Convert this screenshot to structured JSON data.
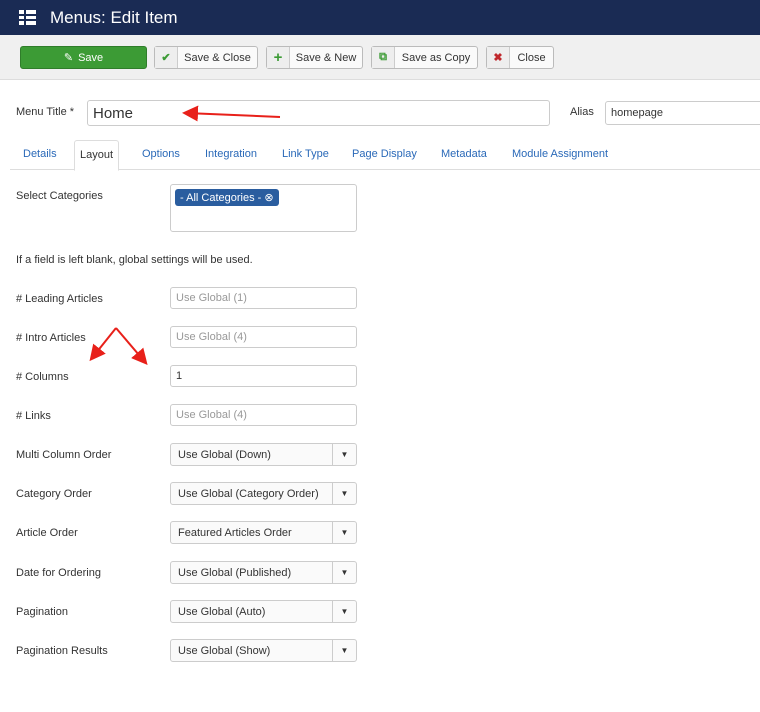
{
  "header": {
    "title": "Menus: Edit Item"
  },
  "toolbar": {
    "save": "Save",
    "save_close": "Save & Close",
    "save_new": "Save & New",
    "save_copy": "Save as Copy",
    "close": "Close"
  },
  "form": {
    "menu_title_label": "Menu Title *",
    "menu_title_value": "Home",
    "alias_label": "Alias",
    "alias_value": "homepage"
  },
  "tabs": [
    "Details",
    "Layout",
    "Options",
    "Integration",
    "Link Type",
    "Page Display",
    "Metadata",
    "Module Assignment"
  ],
  "layout": {
    "select_categories_label": "Select Categories",
    "category_chip": "- All Categories -",
    "note": "If a field is left blank, global settings will be used.",
    "fields": [
      {
        "label": "# Leading Articles",
        "placeholder": "Use Global (1)"
      },
      {
        "label": "# Intro Articles",
        "placeholder": "Use Global (4)"
      },
      {
        "label": "# Columns",
        "value": "1"
      },
      {
        "label": "# Links",
        "placeholder": "Use Global (4)"
      }
    ],
    "selects": [
      {
        "label": "Multi Column Order",
        "value": "Use Global (Down)"
      },
      {
        "label": "Category Order",
        "value": "Use Global (Category Order)"
      },
      {
        "label": "Article Order",
        "value": "Featured Articles Order"
      },
      {
        "label": "Date for Ordering",
        "value": "Use Global (Published)"
      },
      {
        "label": "Pagination",
        "value": "Use Global (Auto)"
      },
      {
        "label": "Pagination Results",
        "value": "Use Global (Show)"
      }
    ]
  },
  "colors": {
    "header": "#1a2b54",
    "save": "#3c9b35",
    "link": "#2a69b8",
    "annotation": "#e8201a"
  }
}
